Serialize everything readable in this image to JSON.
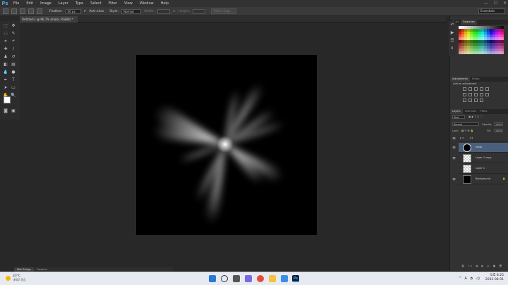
{
  "app": {
    "logo": "Ps"
  },
  "menubar": {
    "items": [
      "File",
      "Edit",
      "Image",
      "Layer",
      "Type",
      "Select",
      "Filter",
      "View",
      "Window",
      "Help"
    ],
    "window_controls": [
      "—",
      "☐",
      "✕"
    ]
  },
  "options_bar": {
    "feather_label": "Feather:",
    "feather_value": "30 px",
    "antialias_label": "Anti-alias",
    "style_label": "Style:",
    "style_value": "Normal",
    "width_label": "Width:",
    "height_label": "Height:",
    "refine_label": "Refine Edge...",
    "workspace_value": "Essentials"
  },
  "document": {
    "tab_title": "Untitled-1 @ 66.7% (mask, RGB/8) *",
    "tab_close": "×"
  },
  "bottom_tabs": [
    "Mini Bridge",
    "Timeline"
  ],
  "panels": {
    "color_tabs": [
      "Color",
      "Swatches"
    ],
    "adjust_tabs": [
      "Adjustments",
      "Styles"
    ],
    "adjust_title": "Add an adjustment",
    "layers_tabs": [
      "Layers",
      "Channels",
      "Paths"
    ],
    "kind_label": "Kind",
    "blend_mode": "Normal",
    "opacity_label": "Opacity:",
    "opacity_value": "100%",
    "lock_label": "Lock:",
    "fill_label": "Fill:",
    "fill_value": "100%",
    "layers": [
      {
        "name": "v1",
        "type": "group"
      },
      {
        "name": "mask",
        "type": "pixel"
      },
      {
        "name": "Layer 1 copy",
        "type": "pixel"
      },
      {
        "name": "Layer 1",
        "type": "pixel"
      },
      {
        "name": "Background",
        "type": "background"
      }
    ]
  },
  "taskbar": {
    "weather_temp": "23°C",
    "weather_desc": "대체로 맑음",
    "clock_period_time": "오후 8:25",
    "date": "2022-08-01",
    "tray_lang": "A"
  },
  "colors": {
    "accent_blue": "#4fa3e0",
    "canvas_bg": "#000000",
    "panel_bg": "#323232",
    "workspace_bg": "#282828"
  }
}
